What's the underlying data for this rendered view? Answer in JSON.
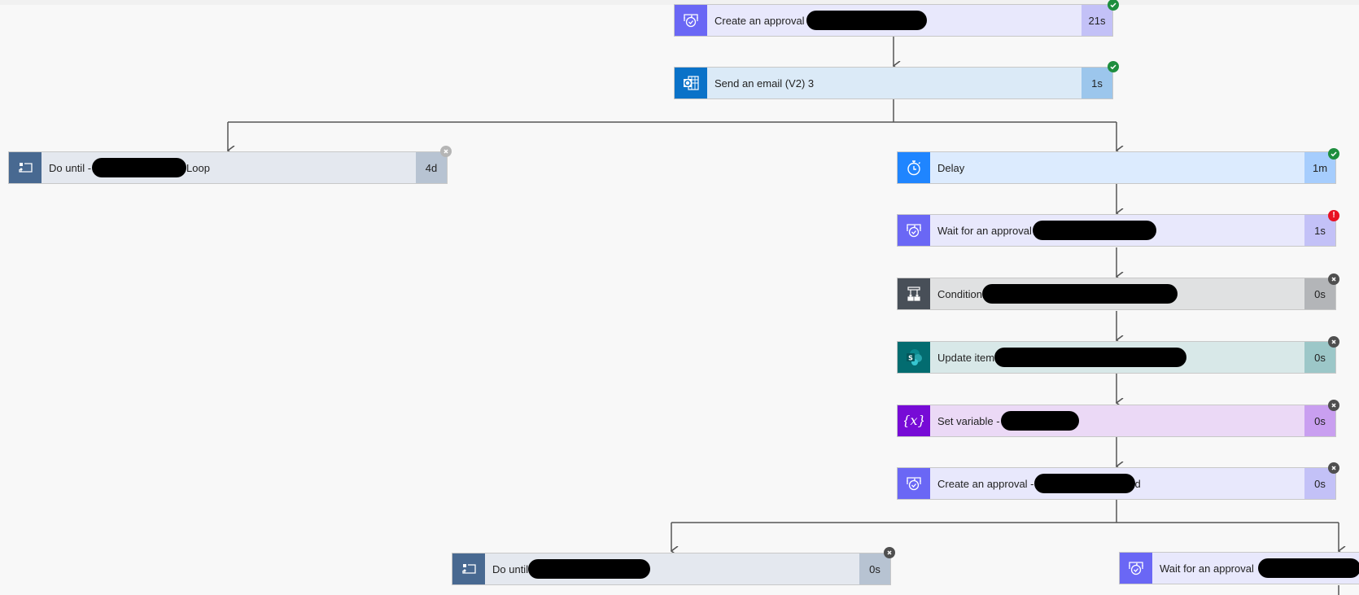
{
  "flow": {
    "actions": [
      {
        "id": "create-approval-1",
        "label": "Create an approval",
        "suffix": "",
        "duration": "21s",
        "status": "success",
        "icon": "approval-icon"
      },
      {
        "id": "send-email",
        "label": "Send an email (V2) 3",
        "suffix": "",
        "duration": "1s",
        "status": "success",
        "icon": "outlook-icon"
      },
      {
        "id": "do-until-1",
        "label": "Do until -",
        "suffix": "Loop",
        "duration": "4d",
        "status": "cancelled",
        "icon": "loop-icon"
      },
      {
        "id": "delay",
        "label": "Delay",
        "suffix": "",
        "duration": "1m",
        "status": "success",
        "icon": "timer-icon"
      },
      {
        "id": "wait-approval-1",
        "label": "Wait for an approval",
        "suffix": "",
        "duration": "1s",
        "status": "failed",
        "icon": "approval-icon"
      },
      {
        "id": "condition",
        "label": "Condition",
        "suffix": "",
        "duration": "0s",
        "status": "skipped",
        "icon": "condition-icon"
      },
      {
        "id": "update-item",
        "label": "Update item",
        "suffix": "",
        "duration": "0s",
        "status": "skipped",
        "icon": "sharepoint-icon"
      },
      {
        "id": "set-variable",
        "label": "Set variable -",
        "suffix": "",
        "duration": "0s",
        "status": "skipped",
        "icon": "variable-icon"
      },
      {
        "id": "create-approval-2",
        "label": "Create an approval -",
        "suffix": "d",
        "duration": "0s",
        "status": "skipped",
        "icon": "approval-icon"
      },
      {
        "id": "do-until-2",
        "label": "Do until",
        "suffix": "",
        "duration": "0s",
        "status": "skipped",
        "icon": "loop-icon"
      },
      {
        "id": "wait-approval-2",
        "label": "Wait for an approval",
        "suffix": "",
        "duration": "",
        "status": "",
        "icon": "approval-icon"
      }
    ],
    "status_colors": {
      "success": "#1e8e3e",
      "failed": "#e81123",
      "skipped": "#4f4f4f",
      "cancelled": "#b5b5b5"
    }
  }
}
